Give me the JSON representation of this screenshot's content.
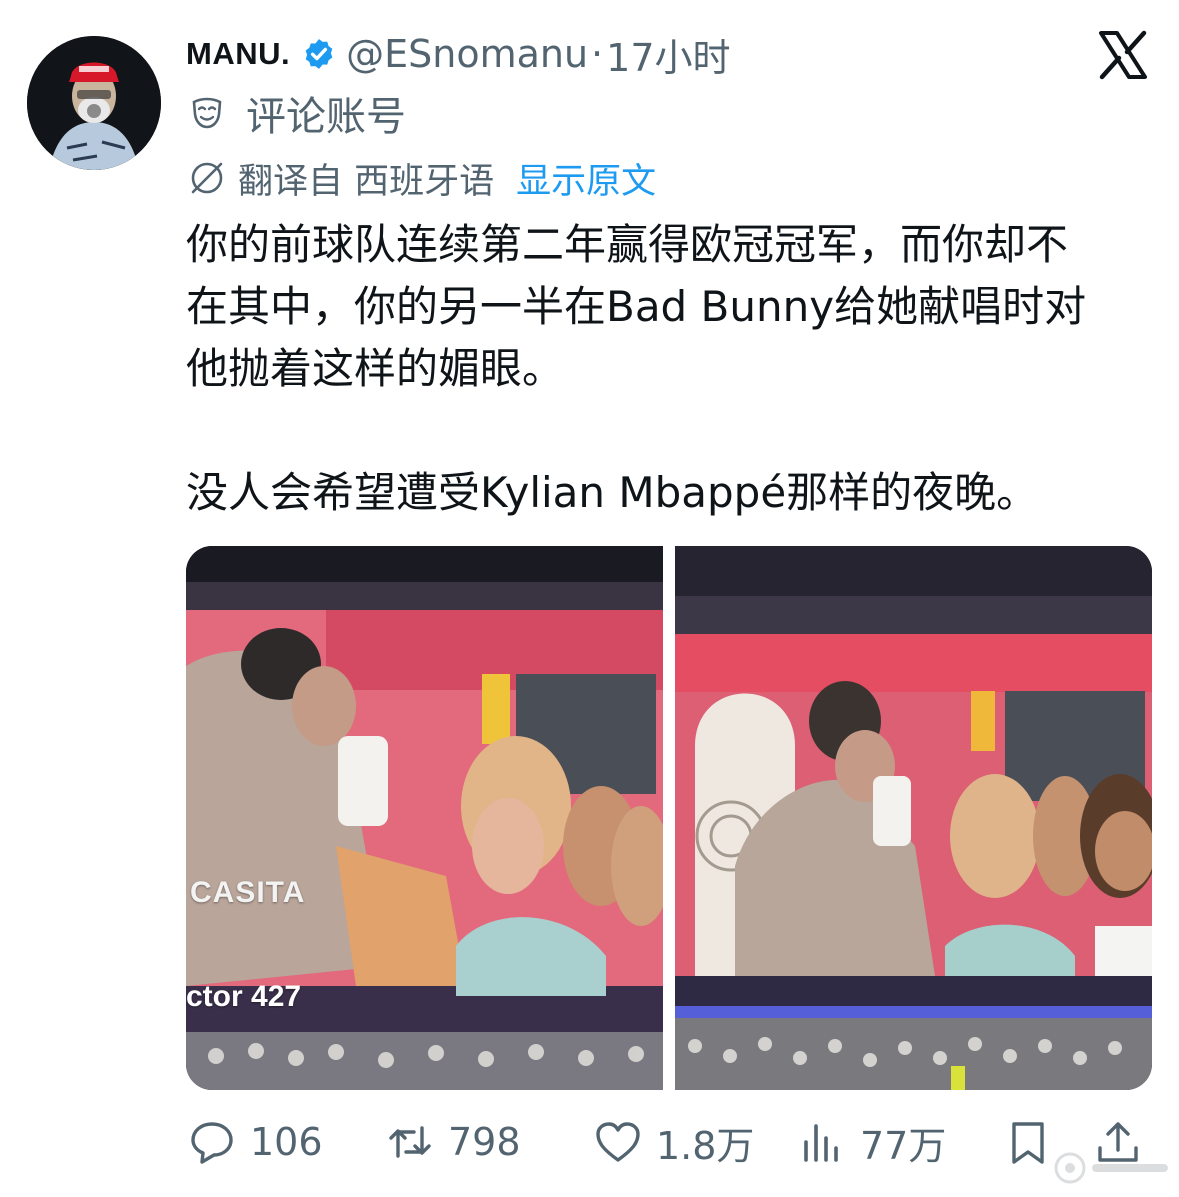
{
  "author": {
    "display_name": "MANU.",
    "handle": "@ESnomanu",
    "separator": "·",
    "time": "17小时",
    "verified": true
  },
  "community": {
    "label": "评论账号",
    "icon": "mask-icon"
  },
  "translation": {
    "label": "翻译自 西班牙语",
    "show_original": "显示原文",
    "link_color": "#1d9bf0"
  },
  "tweet": {
    "text": "你的前球队连续第二年赢得欧冠冠军，而你却不\n在其中，你的另一半在Bad Bunny给她献唱时对\n他抛着这样的媚眼。\n\n没人会希望遭受Kylian Mbappé那样的夜晚。"
  },
  "media": {
    "photo_1": {
      "overlay_top": "CASITA",
      "overlay_bottom": "ctor 427"
    },
    "photo_2": {}
  },
  "actions": {
    "reply": "106",
    "retweet": "798",
    "like": "1.8万",
    "views": "77万"
  },
  "colors": {
    "text_primary": "#0f1419",
    "text_secondary": "#536471",
    "verified": "#1d9bf0"
  }
}
